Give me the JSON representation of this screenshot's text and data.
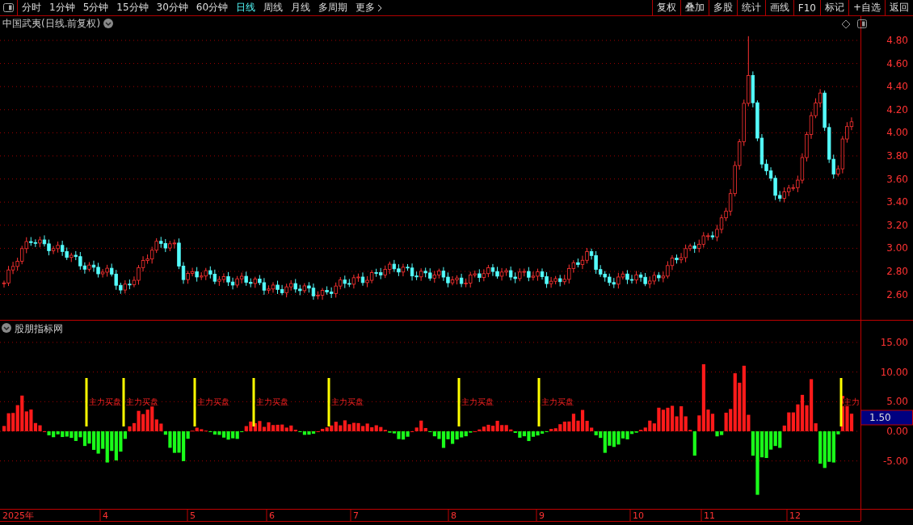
{
  "toolbar": {
    "periods": [
      {
        "label": "分时",
        "selected": false
      },
      {
        "label": "1分钟",
        "selected": false
      },
      {
        "label": "5分钟",
        "selected": false
      },
      {
        "label": "15分钟",
        "selected": false
      },
      {
        "label": "30分钟",
        "selected": false
      },
      {
        "label": "60分钟",
        "selected": false
      },
      {
        "label": "日线",
        "selected": true
      },
      {
        "label": "周线",
        "selected": false
      },
      {
        "label": "月线",
        "selected": false
      },
      {
        "label": "多周期",
        "selected": false
      }
    ],
    "more": "更多",
    "buttons": [
      "复权",
      "叠加",
      "多股",
      "统计",
      "画线",
      "F10",
      "标记",
      "+自选",
      "返回"
    ]
  },
  "price_pane": {
    "title": "中国武夷(日线.前复权)",
    "y_labels": [
      "4.80",
      "4.60",
      "4.40",
      "4.20",
      "4.00",
      "3.80",
      "3.60",
      "3.40",
      "3.20",
      "3.00",
      "2.80",
      "2.60"
    ]
  },
  "indicator_pane": {
    "title": "股朋指标网",
    "y_labels": [
      "15.00",
      "10.00",
      "5.00",
      "0.00",
      "-5.00"
    ],
    "signals": [
      {
        "label": "主力买盘"
      },
      {
        "label": "主力买盘"
      },
      {
        "label": "主力买盘"
      },
      {
        "label": "主力买盘"
      },
      {
        "label": "主力买盘"
      },
      {
        "label": "主力买盘"
      },
      {
        "label": "主力买盘"
      },
      {
        "label": "主力"
      }
    ],
    "current_value": "1.50"
  },
  "date_axis": [
    "2025年",
    "4",
    "5",
    "6",
    "7",
    "8",
    "9",
    "10",
    "11",
    "12"
  ]
}
